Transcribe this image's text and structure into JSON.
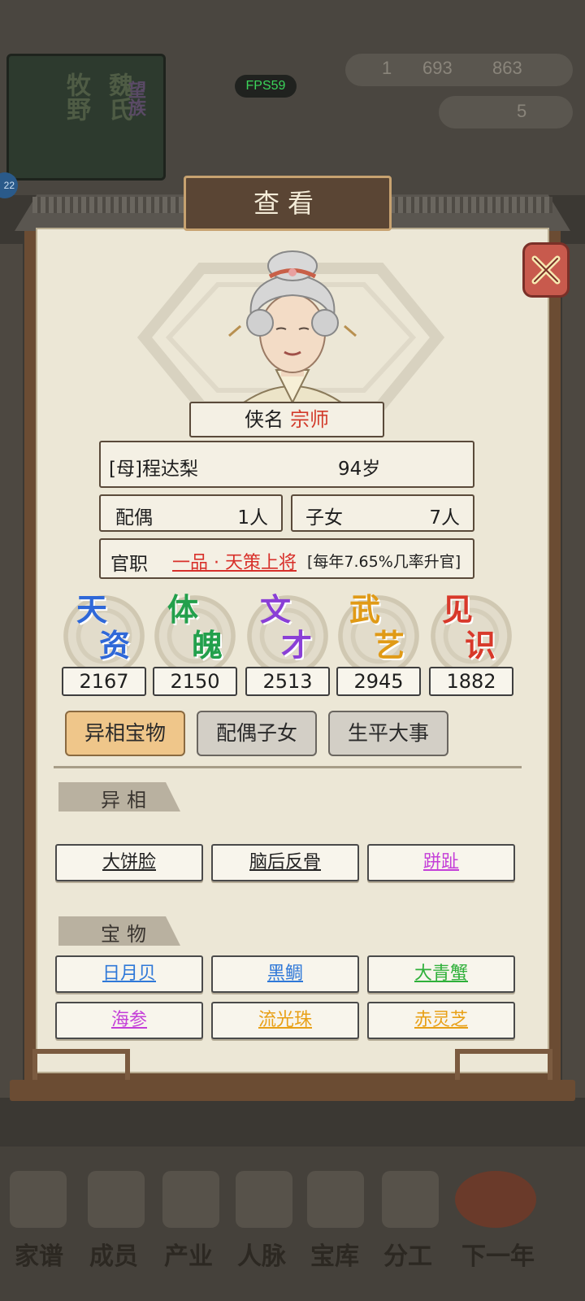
{
  "hud": {
    "fps": "FPS59",
    "resource1": "1",
    "resource2": "693",
    "resource3": "863",
    "resource4": "5",
    "badge": "22"
  },
  "background": {
    "banner_text1": "牧野",
    "banner_text2": "魏氏",
    "banner_text3": "望族"
  },
  "panel": {
    "title": "查看",
    "close_icon": "close-x-icon"
  },
  "character": {
    "nickname_label": "侠名",
    "nickname_value": "宗师",
    "name": "[母]程达梨",
    "age": "94岁",
    "spouse_label": "配偶",
    "spouse_value": "1人",
    "children_label": "子女",
    "children_value": "7人",
    "office_label": "官职",
    "office_value": "一品 · 天策上将",
    "office_note": "[每年7.65%几率升官]"
  },
  "stats": [
    {
      "label1": "天",
      "label2": "资",
      "value": "2167",
      "color": "#2f68d8"
    },
    {
      "label1": "体",
      "label2": "魄",
      "value": "2150",
      "color": "#23a04c"
    },
    {
      "label1": "文",
      "label2": "才",
      "value": "2513",
      "color": "#8a3fd6"
    },
    {
      "label1": "武",
      "label2": "艺",
      "value": "2945",
      "color": "#e09a16"
    },
    {
      "label1": "见",
      "label2": "识",
      "value": "1882",
      "color": "#d8382a"
    }
  ],
  "tabs": [
    {
      "label": "异相宝物",
      "active": true
    },
    {
      "label": "配偶子女",
      "active": false
    },
    {
      "label": "生平大事",
      "active": false
    }
  ],
  "traits": {
    "title": "异相",
    "items": [
      {
        "label": "大饼脸",
        "color": "#222222"
      },
      {
        "label": "脑后反骨",
        "color": "#222222"
      },
      {
        "label": "跰趾",
        "color": "#c43fd8"
      }
    ]
  },
  "treasures": {
    "title": "宝物",
    "items": [
      {
        "label": "日月贝",
        "color": "#2f78d8"
      },
      {
        "label": "黑鲷",
        "color": "#2f78d8"
      },
      {
        "label": "大青蟹",
        "color": "#2fb03a"
      },
      {
        "label": "海参",
        "color": "#c43fd8"
      },
      {
        "label": "流光珠",
        "color": "#e8a016"
      },
      {
        "label": "赤灵芝",
        "color": "#e8a016"
      }
    ]
  },
  "nav": [
    "家谱",
    "成员",
    "产业",
    "人脉",
    "宝库",
    "分工",
    "下一年"
  ]
}
